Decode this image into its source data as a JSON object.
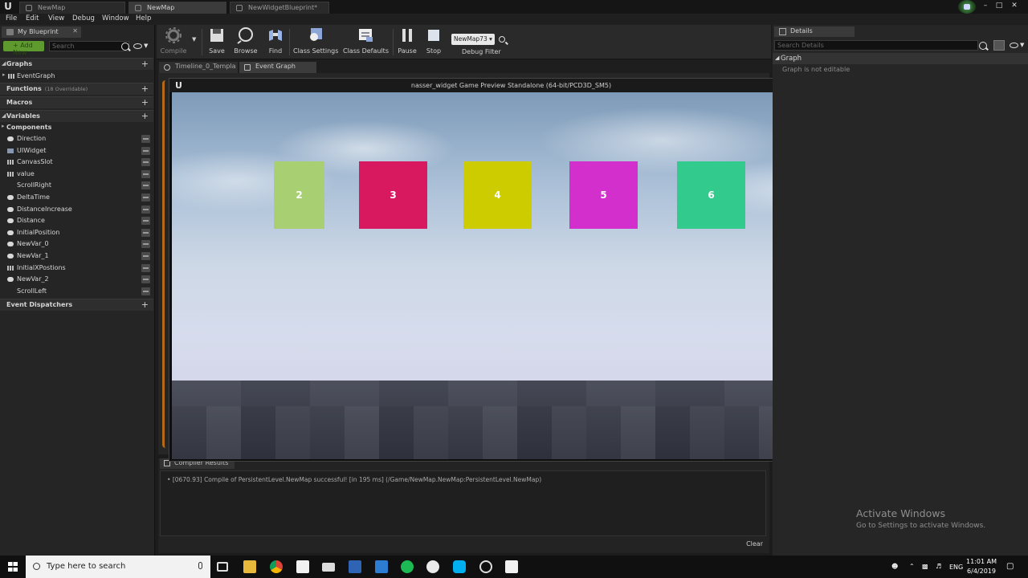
{
  "titlebar": {
    "tabs": [
      "NewMap",
      "NewMap",
      "NewWidgetBlueprint*"
    ]
  },
  "menu": [
    "File",
    "Edit",
    "View",
    "Debug",
    "Window",
    "Help"
  ],
  "left_panel": {
    "tab_label": "My Blueprint",
    "search_placeholder": "Search",
    "sections": {
      "graphs": "Graphs",
      "functions": "Functions",
      "functions_sub": "(18 Overridable)",
      "macros": "Macros",
      "variables": "Variables",
      "components": "Components",
      "dispatchers": "Event Dispatchers"
    },
    "event_graph": "EventGraph",
    "variables": [
      {
        "name": "Direction",
        "icon": "pill"
      },
      {
        "name": "UIWidget",
        "icon": "widget"
      },
      {
        "name": "CanvasSlot",
        "icon": "grid"
      },
      {
        "name": "value",
        "icon": "grid"
      },
      {
        "name": "ScrollRight",
        "icon": "none"
      },
      {
        "name": "DeltaTime",
        "icon": "pill"
      },
      {
        "name": "DistanceIncrease",
        "icon": "pill"
      },
      {
        "name": "Distance",
        "icon": "pill"
      },
      {
        "name": "InitialPosition",
        "icon": "pill"
      },
      {
        "name": "NewVar_0",
        "icon": "pill"
      },
      {
        "name": "NewVar_1",
        "icon": "pill"
      },
      {
        "name": "InitialXPostions",
        "icon": "grid"
      },
      {
        "name": "NewVar_2",
        "icon": "pill"
      },
      {
        "name": "ScrollLeft",
        "icon": "none"
      }
    ]
  },
  "toolbar": {
    "compile": "Compile",
    "save": "Save",
    "browse": "Browse",
    "find": "Find",
    "class_settings": "Class Settings",
    "class_defaults": "Class Defaults",
    "pause": "Pause",
    "stop": "Stop",
    "debug_select": "NewMap73",
    "debug_filter": "Debug Filter"
  },
  "graph_tabs": [
    "Timeline_0_Templa",
    "Event Graph"
  ],
  "preview": {
    "title": "nasser_widget Game Preview Standalone (64-bit/PCD3D_SM5)",
    "tiles": [
      {
        "label": "2",
        "color": "#a8cf72"
      },
      {
        "label": "3",
        "color": "#d8185f"
      },
      {
        "label": "4",
        "color": "#cccc00"
      },
      {
        "label": "5",
        "color": "#d22fcd"
      },
      {
        "label": "6",
        "color": "#32cb8d"
      }
    ]
  },
  "compiler": {
    "tab": "Compiler Results",
    "line": "[0670.93] Compile of PersistentLevel.NewMap successful! [in 195 ms] (/Game/NewMap.NewMap:PersistentLevel.NewMap)",
    "clear": "Clear"
  },
  "details": {
    "tab": "Details",
    "search_placeholder": "Search Details",
    "category": "Graph",
    "note": "Graph is not editable"
  },
  "watermark": {
    "title": "Activate Windows",
    "subtitle": "Go to Settings to activate Windows."
  },
  "taskbar": {
    "search_placeholder": "Type here to search",
    "lang": "ENG",
    "time": "11:01 AM",
    "date": "6/4/2019"
  }
}
